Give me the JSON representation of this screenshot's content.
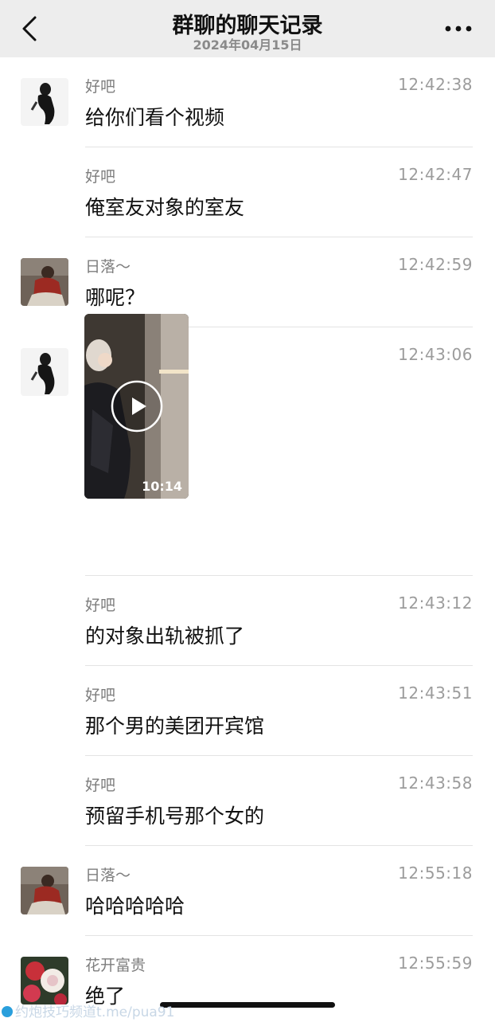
{
  "header": {
    "title": "群聊的聊天记录",
    "date": "2024年04月15日"
  },
  "messages": [
    {
      "sender": "好吧",
      "time": "12:42:38",
      "text": "给你们看个视频",
      "avatar": "silhouette"
    },
    {
      "sender": "好吧",
      "time": "12:42:47",
      "text": "俺室友对象的室友",
      "avatar": ""
    },
    {
      "sender": "日落～",
      "time": "12:42:59",
      "text": "哪呢？",
      "avatar": "person-photo"
    },
    {
      "sender": "好吧",
      "time": "12:43:06",
      "video_duration": "10:14",
      "avatar": "silhouette"
    },
    {
      "sender": "好吧",
      "time": "12:43:12",
      "text": "的对象出轨被抓了",
      "avatar": ""
    },
    {
      "sender": "好吧",
      "time": "12:43:51",
      "text": "那个男的美团开宾馆",
      "avatar": ""
    },
    {
      "sender": "好吧",
      "time": "12:43:58",
      "text": "预留手机号那个女的",
      "avatar": ""
    },
    {
      "sender": "日落～",
      "time": "12:55:18",
      "text": "哈哈哈哈哈",
      "avatar": "person-photo"
    },
    {
      "sender": "花开富贵",
      "time": "12:55:59",
      "text": "绝了",
      "avatar": "flower-photo"
    }
  ],
  "watermark": "约炮技巧频道t.me/pua91",
  "icons": {
    "back": "chevron-left-icon",
    "more": "more-dots-icon",
    "play": "play-icon"
  },
  "colors": {
    "header_bg": "#ededed",
    "divider": "#e3e3e3",
    "time": "#9c9c9c"
  }
}
